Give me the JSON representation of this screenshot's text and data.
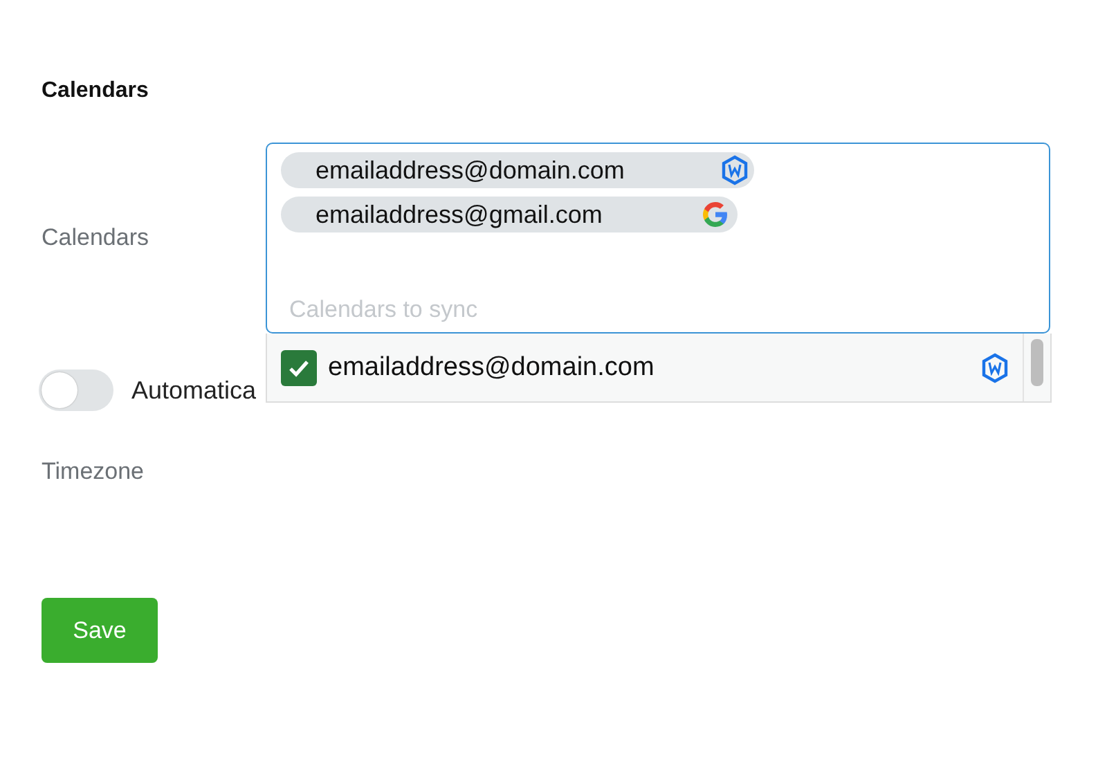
{
  "heading": "Calendars",
  "calendars": {
    "label": "Calendars",
    "chips": [
      {
        "text": "emailaddress@domain.com",
        "kind": "hex"
      },
      {
        "text": "emailaddress@gmail.com",
        "kind": "google"
      }
    ],
    "placeholder": "Calendars to sync",
    "options": [
      {
        "text": "emailaddress@domain.com",
        "checked": true,
        "kind": "hex"
      }
    ]
  },
  "auto": {
    "label": "Automatica",
    "on": false
  },
  "timezone": {
    "label": "Timezone"
  },
  "save": "Save"
}
